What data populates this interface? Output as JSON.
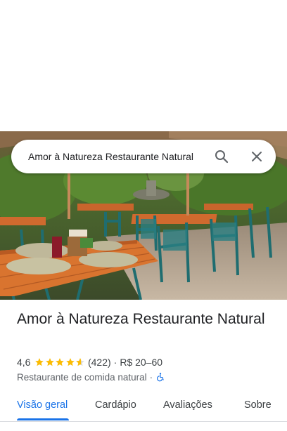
{
  "search": {
    "query": "Amor à Natureza Restaurante Natural",
    "search_icon": "search-icon",
    "close_icon": "close-icon"
  },
  "place": {
    "name": "Amor à Natureza Restaurante Natural",
    "rating": "4,6",
    "rating_value": 4.6,
    "review_count": "(422)",
    "separator": "·",
    "price": "R$ 20–60",
    "category": "Restaurante de comida natural",
    "category_separator": "·",
    "accessibility_icon": "wheelchair-icon"
  },
  "tabs": [
    {
      "label": "Visão geral",
      "active": true
    },
    {
      "label": "Cardápio",
      "active": false
    },
    {
      "label": "Avaliações",
      "active": false
    },
    {
      "label": "Sobre",
      "active": false
    }
  ],
  "colors": {
    "accent": "#1a73e8",
    "star": "#fbbc04",
    "text": "#202124"
  }
}
